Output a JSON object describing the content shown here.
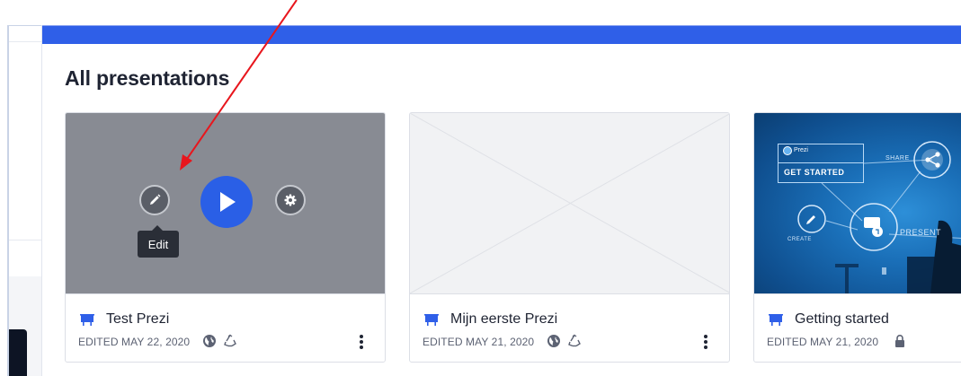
{
  "page": {
    "title": "All presentations"
  },
  "colors": {
    "brand_blue": "#2f5fe8",
    "play_blue": "#2a5fe6",
    "title_text": "#1f2433",
    "meta_text": "#5c6273",
    "annotation_red": "#e8161d"
  },
  "cards": [
    {
      "title": "Test Prezi",
      "edited": "EDITED MAY 22, 2020",
      "icons": [
        "globe-icon",
        "recycle-icon"
      ],
      "tooltip": "Edit",
      "hover_actions": [
        "edit-pencil-icon",
        "play-icon",
        "gear-icon"
      ]
    },
    {
      "title": "Mijn eerste Prezi",
      "edited": "EDITED MAY 21, 2020",
      "icons": [
        "globe-icon",
        "recycle-icon"
      ]
    },
    {
      "title": "Getting started",
      "edited": "EDITED MAY 21, 2020",
      "icons": [
        "lock-icon"
      ],
      "thumbnail": {
        "logo_text": "Prezi",
        "heading": "GET STARTED",
        "share_label": "SHARE",
        "present_label": "PRESENT",
        "create_label": "CREATE"
      }
    }
  ]
}
